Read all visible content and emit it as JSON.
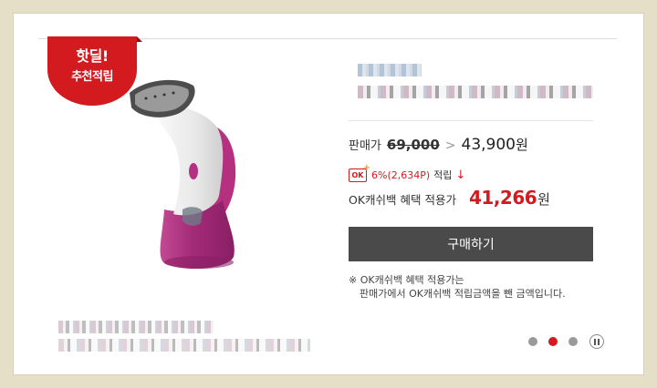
{
  "badge": {
    "line1": "핫딜!",
    "line2": "추천적립"
  },
  "price": {
    "label": "판매가",
    "original": "69,000",
    "arrow": ">",
    "sale": "43,900",
    "unit": "원"
  },
  "ok_cashbag": {
    "icon_text": "OK",
    "rate": "6%(2,634P)",
    "suffix": "적립",
    "arrow": "↓"
  },
  "benefit": {
    "label": "OK캐쉬백 혜택 적용가",
    "price": "41,266",
    "unit": "원"
  },
  "buy_button": {
    "label": "구매하기"
  },
  "notes": {
    "line1": "※ OK캐쉬백 혜택 적용가는",
    "line2": "판매가에서 OK캐쉬백 적립금액을 뺀 금액입니다."
  },
  "carousel": {
    "dot_count": 3,
    "active_index": 1
  },
  "colors": {
    "accent": "#d21a1f",
    "button": "#4a4a4a",
    "product": "#b5307f"
  }
}
